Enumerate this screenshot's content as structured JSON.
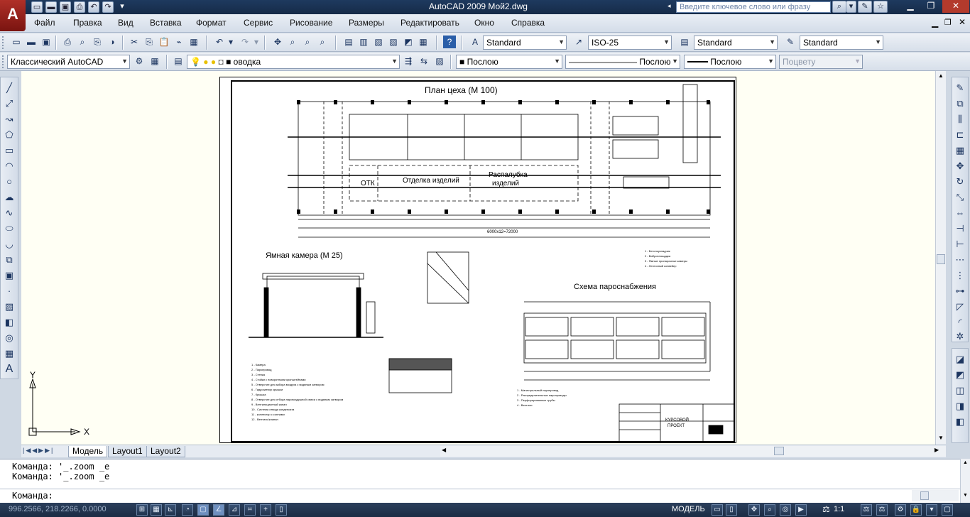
{
  "app": {
    "logo": "A",
    "title": "AutoCAD 2009  Мой2.dwg",
    "search_placeholder": "Введите ключевое слово или фразу"
  },
  "menu": [
    "Файл",
    "Правка",
    "Вид",
    "Вставка",
    "Формат",
    "Сервис",
    "Рисование",
    "Размеры",
    "Редактировать",
    "Окно",
    "Справка"
  ],
  "toolbar": {
    "text_style": "Standard",
    "dim_style": "ISO-25",
    "table_style": "Standard",
    "multileader_style": "Standard",
    "workspace": "Классический AutoCAD",
    "layer": "оводка",
    "color": "Послою",
    "linetype": "Послою",
    "lineweight": "Послою",
    "plot_style": "Поцвету"
  },
  "drawing": {
    "plan_title": "План цеха (М 100)",
    "room_otk": "ОТК",
    "room_finishing": "Отделка изделий",
    "room_unmolding": "Распалубка",
    "room_unmolding2": "изделий",
    "overall_dim": "6000х12=72000",
    "pit_title": "Ямная камера (М 25)",
    "steam_title": "Схема пароснабжения",
    "stamp_title": "КУРСОВОЙ",
    "stamp_title2": "ПРОЕКТ",
    "pit_legend": [
      "1 - Камера",
      "2 - Паропровод",
      "3 - Стенка",
      "4 - Стойки с поворотными кронштейнами",
      "5 - Отверстие для забора воздуха с водяным затвором",
      "6 - Гидрозатвор крышки",
      "7 - Крышка",
      "8 - Отверстие для отбора паровоздушной смеси с водяным затвором",
      "9 - Вентиляционный канал",
      "10 - Система отвода конденсата",
      "11 - коллектор с соплами",
      "12 - Вентиль/клапан"
    ],
    "steam_legend": [
      "1 - Магистральный паропровод",
      "2 - Распределительные паропроводы",
      "3 - Перфорированные трубы",
      "4 - Вентили"
    ],
    "plan_legend": [
      "1 - Бетоноукладчик",
      "2 - Виброплощадка",
      "3 - Ямные пропарочные камеры",
      "4 - Ленточный конвейер"
    ]
  },
  "tabs": [
    "Модель",
    "Layout1",
    "Layout2"
  ],
  "command": {
    "history": [
      "Команда: '_.zoom _e",
      "Команда: '_.zoom _e"
    ],
    "prompt": "Команда:"
  },
  "status": {
    "coords": "996.2566, 218.2266, 0.0000",
    "space": "МОДЕЛЬ",
    "scale": "1:1"
  }
}
